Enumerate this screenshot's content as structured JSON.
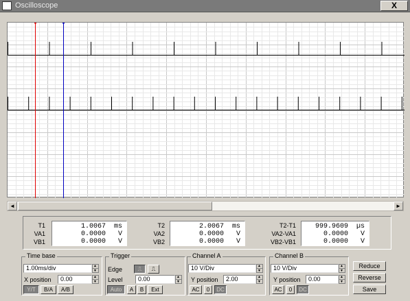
{
  "window": {
    "title": "Oscilloscope",
    "close_label": "X"
  },
  "cursors": [
    {
      "label": "1",
      "color": "#e00000"
    },
    {
      "label": "2",
      "color": "#0000c0"
    }
  ],
  "readouts": {
    "t1": {
      "label": "T1",
      "value": "1.0067",
      "unit": "ms"
    },
    "va1": {
      "label": "VA1",
      "value": "0.0000",
      "unit": "V"
    },
    "vb1": {
      "label": "VB1",
      "value": "0.0000",
      "unit": "V"
    },
    "t2": {
      "label": "T2",
      "value": "2.0067",
      "unit": "ms"
    },
    "va2": {
      "label": "VA2",
      "value": "0.0000",
      "unit": "V"
    },
    "vb2": {
      "label": "VB2",
      "value": "0.0000",
      "unit": "V"
    },
    "dt": {
      "label": "T2-T1",
      "value": "999.9609",
      "unit": "µs"
    },
    "dva": {
      "label": "VA2-VA1",
      "value": "0.0000",
      "unit": "V"
    },
    "dvb": {
      "label": "VB2-VB1",
      "value": "0.0000",
      "unit": "V"
    }
  },
  "timebase": {
    "title": "Time base",
    "scale": "1.00ms/div",
    "xpos_label": "X position",
    "xpos_value": "0.00",
    "buttons": [
      "Y/T",
      "B/A",
      "A/B"
    ],
    "active": "Y/T"
  },
  "trigger": {
    "title": "Trigger",
    "edge_label": "Edge",
    "level_label": "Level",
    "level_value": "0.00",
    "buttons": [
      "Auto",
      "A",
      "B",
      "Ext"
    ]
  },
  "channel_a": {
    "title": "Channel A",
    "scale": "10 V/Div",
    "ypos_label": "Y position",
    "ypos_value": "2.00",
    "buttons": [
      "AC",
      "0",
      "DC"
    ]
  },
  "channel_b": {
    "title": "Channel B",
    "scale": "10 V/Div",
    "ypos_label": "Y position",
    "ypos_value": "0.00",
    "buttons": [
      "AC",
      "0",
      "DC"
    ]
  },
  "actions": {
    "reduce": "Reduce",
    "reverse": "Reverse",
    "save": "Save"
  },
  "colors": {
    "trace": "#000000",
    "grid": "#c8c8c8",
    "screen_bg": "#ffffff",
    "cursor1": "#e00000",
    "cursor2": "#0000c0"
  }
}
